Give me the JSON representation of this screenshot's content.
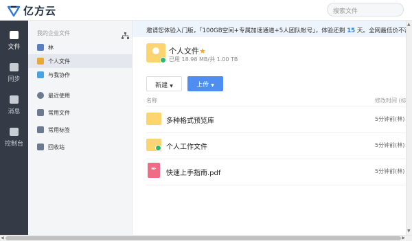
{
  "app": {
    "logo_text": "亿方云",
    "brand_color": "#2f78d8"
  },
  "search": {
    "placeholder": "搜索文件"
  },
  "leftnav": {
    "items": [
      {
        "label": "文件",
        "icon": "file-icon",
        "active": true
      },
      {
        "label": "同步",
        "icon": "sync-icon",
        "active": false
      },
      {
        "label": "消息",
        "icon": "message-icon",
        "active": false
      },
      {
        "label": "控制台",
        "icon": "console-icon",
        "active": false
      }
    ]
  },
  "sidebar": {
    "header": "我的企业文件",
    "items": [
      {
        "label": "林",
        "icon": "team-folder-icon"
      },
      {
        "label": "个人文件",
        "icon": "personal-folder-icon",
        "active": true
      },
      {
        "label": "与我协作",
        "icon": "collab-icon"
      },
      {
        "label": "最近使用",
        "icon": "recent-icon"
      },
      {
        "label": "常用文件",
        "icon": "favorite-icon"
      },
      {
        "label": "常用标签",
        "icon": "tag-icon"
      },
      {
        "label": "回收站",
        "icon": "trash-icon"
      }
    ]
  },
  "notice": {
    "prefix": "邀请您体验入门版，「100GB空间+专属加速通道+5人团队帐号」，体验还剩",
    "days": "15",
    "suffix": "天。全网最低价不容错过。"
  },
  "folder": {
    "title": "个人文件",
    "usage": "已用 18.98 MB/共 1.00 TB"
  },
  "toolbar": {
    "new_label": "新建",
    "upload_label": "上传"
  },
  "table": {
    "col_name": "名称",
    "col_time": "修改时间 (标",
    "rows": [
      {
        "name": "多种格式预览库",
        "time": "5分钟前(林)",
        "type": "folder"
      },
      {
        "name": "个人工作文件",
        "time": "5分钟前(林)",
        "type": "synced-folder"
      },
      {
        "name": "快速上手指南.pdf",
        "time": "5分钟前(林)",
        "type": "pdf"
      }
    ]
  }
}
